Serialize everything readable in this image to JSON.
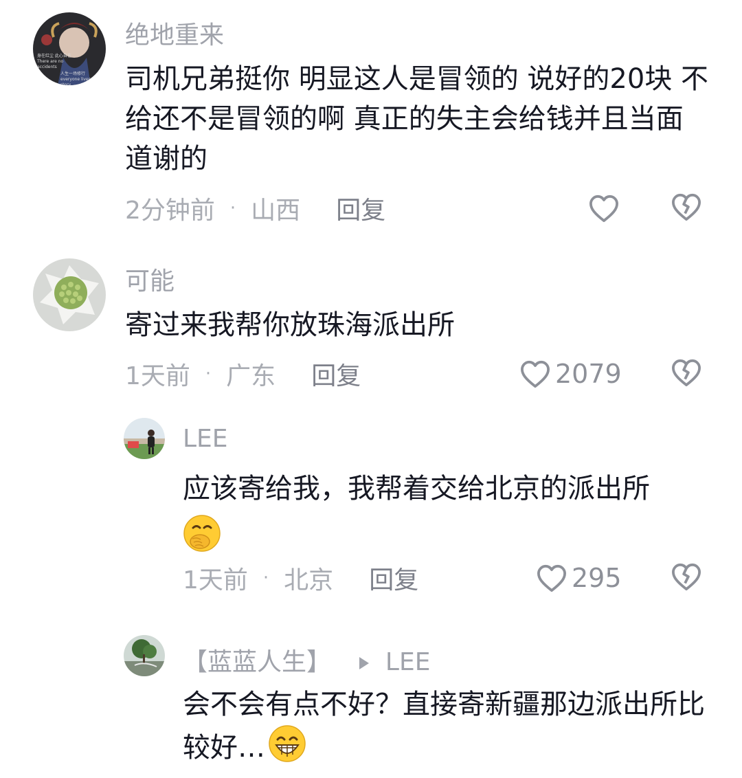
{
  "comments": [
    {
      "username": "绝地重来",
      "avatar_text_1": "身在红尘 此心自在",
      "avatar_text_2": "There are no accidents",
      "avatar_text_3": "人生一场修行",
      "avatar_text_4": "everyone lives a story",
      "text": "司机兄弟挺你 明显这人是冒领的 说好的20块 不给还不是冒领的啊 真正的失主会给钱并且当面道谢的",
      "time": "2分钟前",
      "location": "山西",
      "reply_label": "回复",
      "like_count": ""
    },
    {
      "username": "可能",
      "text": "寄过来我帮你放珠海派出所",
      "time": "1天前",
      "location": "广东",
      "reply_label": "回复",
      "like_count": "2079"
    },
    {
      "username": "LEE",
      "text": "应该寄给我，我帮着交给北京的派出所",
      "time": "1天前",
      "location": "北京",
      "reply_label": "回复",
      "like_count": "295"
    },
    {
      "username": "【蓝蓝人生】",
      "reply_to": "LEE",
      "text": "会不会有点不好？直接寄新疆那边派出所比较好…",
      "time": "",
      "location": "",
      "reply_label": ""
    }
  ],
  "colors": {
    "text_primary": "#161823",
    "text_secondary": "#a0a3ab",
    "icon_gray": "#8d9098"
  },
  "icons": [
    "heart-outline-icon",
    "broken-heart-icon",
    "face-hand-over-mouth-emoji",
    "grinning-emoji"
  ]
}
